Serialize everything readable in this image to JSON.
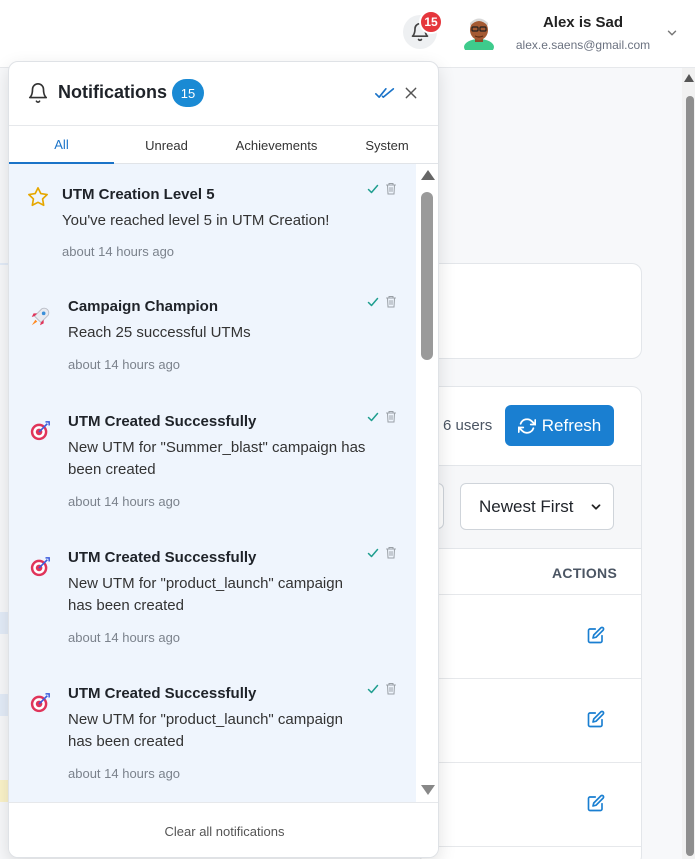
{
  "header": {
    "notification_count": "15",
    "user_name": "Alex is Sad",
    "user_email": "alex.e.saens@gmail.com"
  },
  "background": {
    "users_count": "6 users",
    "refresh_label": "Refresh",
    "sort_selected": "Newest First",
    "actions_header": "ACTIONS"
  },
  "panel": {
    "title": "Notifications",
    "badge": "15",
    "tabs": [
      "All",
      "Unread",
      "Achievements",
      "System"
    ],
    "active_tab": "All",
    "clear_all_label": "Clear all notifications",
    "items": [
      {
        "icon": "star-icon",
        "title": "UTM Creation Level 5",
        "message": "You've reached level 5 in UTM Creation!",
        "time": "about 14 hours ago"
      },
      {
        "icon": "rocket-icon",
        "title": "Campaign Champion",
        "message": "Reach 25 successful UTMs",
        "time": "about 14 hours ago"
      },
      {
        "icon": "target-icon",
        "title": "UTM Created Successfully",
        "message": "New UTM for \"Summer_blast\" campaign has been created",
        "time": "about 14 hours ago"
      },
      {
        "icon": "target-icon",
        "title": "UTM Created Successfully",
        "message": "New UTM for \"product_launch\" campaign has been created",
        "time": "about 14 hours ago"
      },
      {
        "icon": "target-icon",
        "title": "UTM Created Successfully",
        "message": "New UTM for \"product_launch\" campaign has been created",
        "time": "about 14 hours ago"
      }
    ]
  },
  "colors": {
    "accent": "#1a73c8",
    "badge_red": "#e5363c",
    "unread_bg": "#eff5fd",
    "check_teal": "#1f9e8f"
  }
}
